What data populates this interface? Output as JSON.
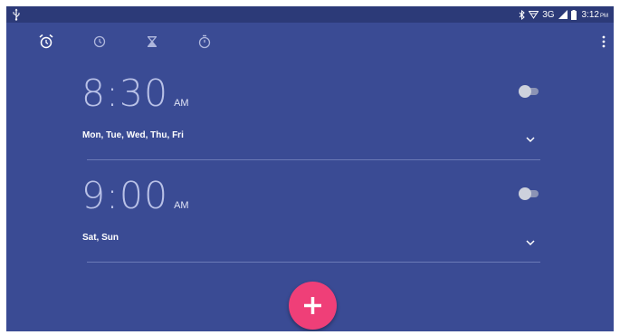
{
  "status_bar": {
    "network": "3G",
    "time": "3:12",
    "ampm": "PM",
    "icons": [
      "usb-icon",
      "bluetooth-icon",
      "wifi-icon",
      "signal-icon",
      "battery-icon"
    ]
  },
  "tabs": [
    {
      "name": "alarm",
      "icon": "alarm-clock-icon"
    },
    {
      "name": "clock",
      "icon": "clock-icon"
    },
    {
      "name": "timer",
      "icon": "hourglass-icon"
    },
    {
      "name": "stopwatch",
      "icon": "stopwatch-icon"
    }
  ],
  "alarms": [
    {
      "time": "8:30",
      "ampm": "AM",
      "days": "Mon, Tue, Wed, Thu, Fri",
      "enabled": false
    },
    {
      "time": "9:00",
      "ampm": "AM",
      "days": "Sat, Sun",
      "enabled": false
    }
  ],
  "colors": {
    "background": "#3a4b94",
    "status_bar": "#2c3a78",
    "fab": "#ef3f78"
  }
}
